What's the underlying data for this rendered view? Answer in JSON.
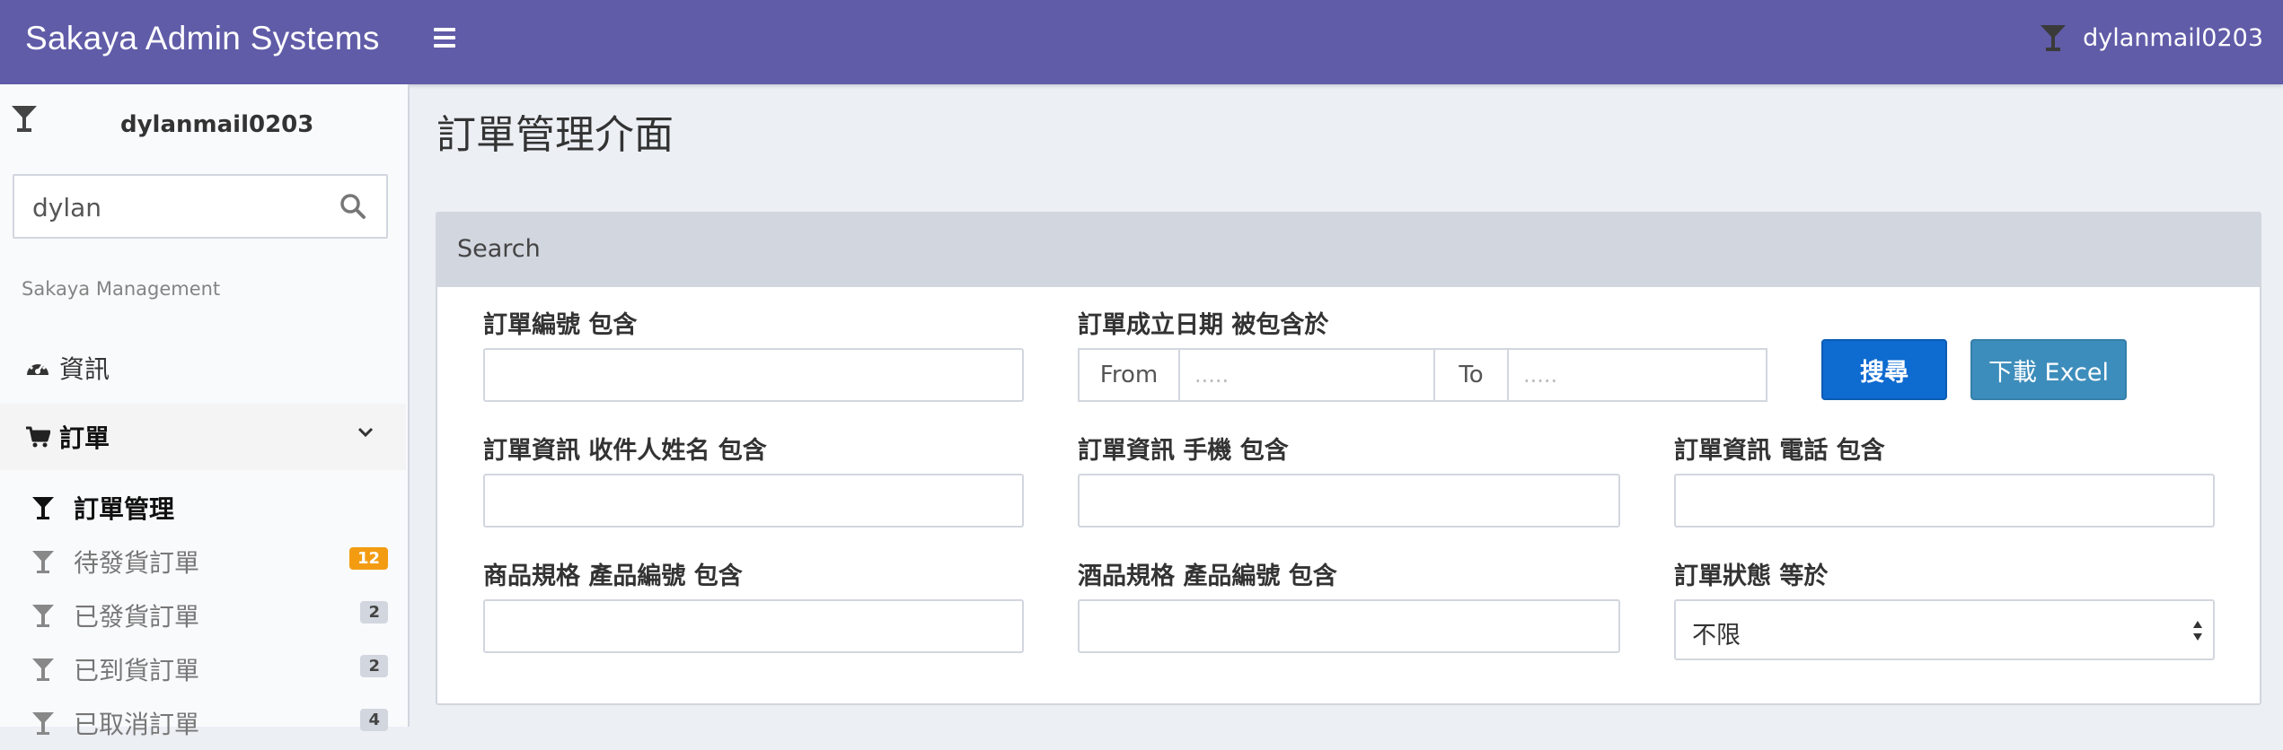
{
  "topbar": {
    "brand": "Sakaya Admin Systems",
    "user": "dylanmail0203"
  },
  "sidebar": {
    "user_name": "dylanmail0203",
    "search_value": "dylan",
    "section_header": "Sakaya Management",
    "dashboard_label": "資訊",
    "orders_label": "訂單",
    "sub_items": [
      {
        "label": "訂單管理",
        "badge": ""
      },
      {
        "label": "待發貨訂單",
        "badge": "12"
      },
      {
        "label": "已發貨訂單",
        "badge": "2"
      },
      {
        "label": "已到貨訂單",
        "badge": "2"
      },
      {
        "label": "已取消訂單",
        "badge": "4"
      }
    ]
  },
  "main": {
    "page_title": "訂單管理介面",
    "box_title": "Search",
    "fields": {
      "order_no": "訂單編號 包含",
      "order_date": "訂單成立日期 被包含於",
      "recipient": "訂單資訊 收件人姓名 包含",
      "mobile": "訂單資訊 手機 包含",
      "phone": "訂單資訊 電話 包含",
      "spec_no": "商品規格 產品編號 包含",
      "wine_no": "酒品規格 產品編號 包含",
      "status": "訂單狀態 等於"
    },
    "date_from_label": "From",
    "date_to_label": "To",
    "date_placeholder": ".....",
    "search_button": "搜尋",
    "excel_button": "下載 Excel",
    "status_value": "不限"
  },
  "colors": {
    "topbar": "#605ca8",
    "search_button": "#0e6bd0",
    "excel_button": "#3c8dbc",
    "badge_orange": "#f39c12"
  }
}
